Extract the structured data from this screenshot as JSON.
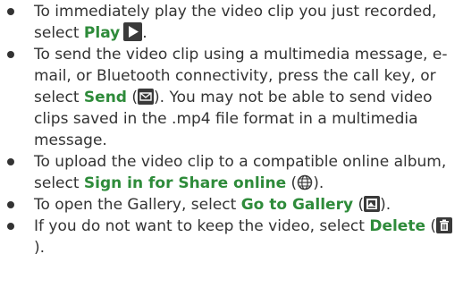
{
  "items": [
    {
      "text_before": "To immediately play the video clip you just recorded, select ",
      "keyword": "Play",
      "text_after": ".",
      "icon": "play-icon"
    },
    {
      "text_before": "To send the video clip using a multimedia message, e-mail, or Bluetooth connectivity, press the call key, or select ",
      "keyword": "Send",
      "paren_open": " (",
      "paren_close": ")",
      "text_after": ". You may not be able to send video clips saved in the .mp4 file format in a multimedia message.",
      "icon": "envelope-icon"
    },
    {
      "text_before": "To upload the video clip to a compatible online album, select ",
      "keyword": "Sign in for Share online",
      "paren_open": " (",
      "paren_close": ")",
      "text_after": ".",
      "icon": "globe-icon"
    },
    {
      "text_before": "To open the Gallery, select ",
      "keyword": "Go to Gallery",
      "paren_open": " (",
      "paren_close": ")",
      "text_after": ".",
      "icon": "gallery-icon"
    },
    {
      "text_before": "If you do not want to keep the video, select ",
      "keyword": "Delete",
      "paren_open": " (",
      "paren_close": ")",
      "text_after": ".",
      "icon": "trash-icon"
    }
  ],
  "colors": {
    "keyword": "#2e8b3a",
    "text": "#333333",
    "icon_background": "#3a3a3a"
  }
}
